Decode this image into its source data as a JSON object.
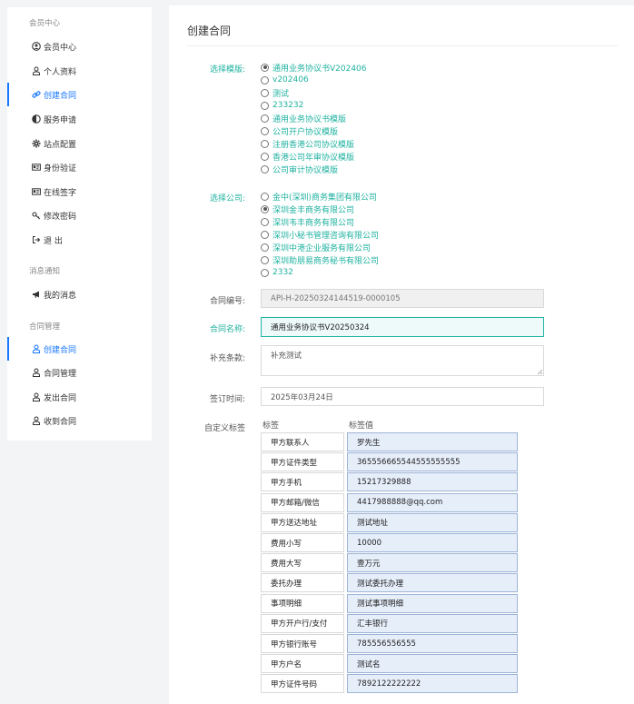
{
  "sidebar": {
    "sections": [
      {
        "title": "会员中心",
        "items": [
          {
            "label": "会员中心",
            "icon": "user-circle-icon",
            "active": false
          },
          {
            "label": "个人资料",
            "icon": "person-icon",
            "active": false
          },
          {
            "label": "创建合同",
            "icon": "link-icon",
            "active": true
          },
          {
            "label": "服务申请",
            "icon": "half-circle-icon",
            "active": false
          },
          {
            "label": "站点配置",
            "icon": "gear-icon",
            "active": false
          },
          {
            "label": "身份验证",
            "icon": "id-card-icon",
            "active": false
          },
          {
            "label": "在线签字",
            "icon": "id-card-icon",
            "active": false
          },
          {
            "label": "修改密码",
            "icon": "key-icon",
            "active": false
          },
          {
            "label": "退 出",
            "icon": "sign-out-icon",
            "active": false
          }
        ]
      },
      {
        "title": "消息通知",
        "items": [
          {
            "label": "我的消息",
            "icon": "bullhorn-icon",
            "active": false
          }
        ]
      },
      {
        "title": "合同管理",
        "items": [
          {
            "label": "创建合同",
            "icon": "person-icon",
            "active": true
          },
          {
            "label": "合同管理",
            "icon": "person-icon",
            "active": false
          },
          {
            "label": "发出合同",
            "icon": "person-icon",
            "active": false
          },
          {
            "label": "收到合同",
            "icon": "person-icon",
            "active": false
          }
        ]
      }
    ]
  },
  "main": {
    "title": "创建合同",
    "template": {
      "label": "选择模版:",
      "options": [
        {
          "label": "通用业务协议书V202406",
          "checked": true
        },
        {
          "label": "v202406",
          "checked": false
        },
        {
          "label": "测试",
          "checked": false
        },
        {
          "label": "233232",
          "checked": false
        },
        {
          "label": "通用业务协议书模版",
          "checked": false
        },
        {
          "label": "公司开户协议模版",
          "checked": false
        },
        {
          "label": "注册香港公司协议模版",
          "checked": false
        },
        {
          "label": "香港公司年审协议模版",
          "checked": false
        },
        {
          "label": "公司审计协议模版",
          "checked": false
        }
      ]
    },
    "company": {
      "label": "选择公司:",
      "options": [
        {
          "label": "金中(深圳)商务集团有限公司",
          "checked": false
        },
        {
          "label": "深圳金丰商务有限公司",
          "checked": true
        },
        {
          "label": "深圳韦丰商务有限公司",
          "checked": false
        },
        {
          "label": "深圳小秘书管理咨询有限公司",
          "checked": false
        },
        {
          "label": "深圳中港企业服务有限公司",
          "checked": false
        },
        {
          "label": "深圳助朋易商务秘书有限公司",
          "checked": false
        },
        {
          "label": "2332",
          "checked": false
        }
      ]
    },
    "contract_no": {
      "label": "合同编号:",
      "value": "API-H-20250324144519-0000105"
    },
    "contract_name": {
      "label": "合同名称:",
      "value": "通用业务协议书V20250324"
    },
    "supplement": {
      "label": "补充条款:",
      "value": "补充测试"
    },
    "sign_date": {
      "label": "签订时间:",
      "value": "2025年03月24日"
    },
    "custom_tags": {
      "label": "自定义标签",
      "col_key": "标签",
      "col_val": "标签值",
      "rows": [
        {
          "key": "甲方联系人",
          "value": "罗先生"
        },
        {
          "key": "甲方证件类型",
          "value": "365556665544555555555"
        },
        {
          "key": "甲方手机",
          "value": "15217329888"
        },
        {
          "key": "甲方邮箱/微信",
          "value": "4417988888@qq.com"
        },
        {
          "key": "甲方送达地址",
          "value": "测试地址"
        },
        {
          "key": "费用小写",
          "value": "10000"
        },
        {
          "key": "费用大写",
          "value": "壹万元"
        },
        {
          "key": "委托办理",
          "value": "测试委托办理"
        },
        {
          "key": "事项明细",
          "value": "测试事项明细"
        },
        {
          "key": "甲方开户行/支付",
          "value": "汇丰银行"
        },
        {
          "key": "甲方银行账号",
          "value": "785556556555"
        },
        {
          "key": "甲方户名",
          "value": "测试名"
        },
        {
          "key": "甲方证件号码",
          "value": "7892122222222"
        }
      ]
    }
  },
  "colors": {
    "accent_blue": "#1677ff",
    "accent_green": "#20b2a0",
    "tag_value_bg": "#e6eefa"
  }
}
